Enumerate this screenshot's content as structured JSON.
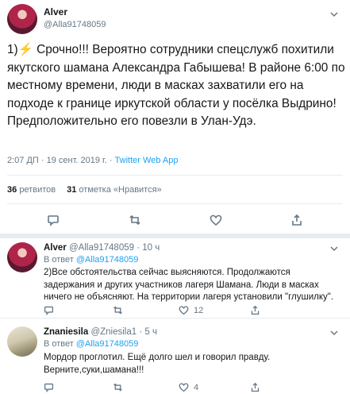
{
  "main_tweet": {
    "author_name": "Alver",
    "author_handle": "@Alla91748059",
    "text_prefix": "1)",
    "bolt_glyph": "⚡",
    "text": " Срочно!!! Вероятно сотрудники спецслужб похитили якутского шамана Александра Габышева! В районе 6:00 по местному времени, люди в масках захватили его на подходе к границе иркутской области у посёлка Выдрино! Предположительно его повезли в Улан-Удэ.",
    "time": "2:07 ДП · 19 сент. 2019 г. · ",
    "source": "Twitter Web App",
    "retweets_count": "36",
    "retweets_label": "ретвитов",
    "likes_count": "31",
    "likes_label": "отметка «Нравится»"
  },
  "replies": [
    {
      "author_name": "Alver",
      "author_handle": "@Alla91748059 · 10 ч",
      "reply_to_prefix": "В ответ ",
      "reply_to_handle": "@Alla91748059",
      "text": "2)Все обстоятельства сейчас выясняются. Продолжаются задержания и других участников лагеря Шамана. Люди в масках ничего не объясняют. На территории лагеря установили \"глушилку\".",
      "reply_count": "",
      "retweet_count": "",
      "like_count": "12"
    },
    {
      "author_name": "Znaniesila",
      "author_handle": "@Zniesila1 · 5 ч",
      "reply_to_prefix": "В ответ ",
      "reply_to_handle": "@Alla91748059",
      "text": "Мордор проглотил. Ещё долго шел и говорил правду. Верните,суки,шамана!!!",
      "reply_count": "",
      "retweet_count": "",
      "like_count": "4"
    }
  ],
  "icons": [
    "reply-icon",
    "retweet-icon",
    "like-icon",
    "share-icon",
    "chevron-down-icon"
  ],
  "colors": {
    "link": "#1da1f2",
    "muted": "#657786",
    "divider": "#e6ecf0"
  }
}
